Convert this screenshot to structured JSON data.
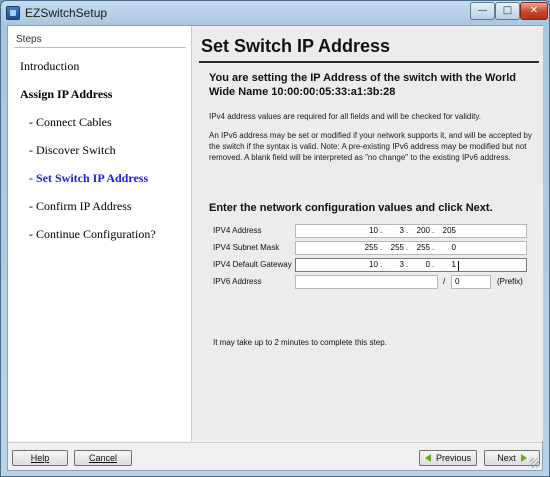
{
  "window": {
    "title": "EZSwitchSetup",
    "minimize_glyph": "—",
    "maximize_glyph": "□",
    "close_glyph": "✕",
    "icon": "app-icon"
  },
  "sidebar": {
    "heading": "Steps",
    "steps": [
      {
        "label": "Introduction",
        "state": "normal"
      },
      {
        "label": "Assign IP Address",
        "state": "bold"
      },
      {
        "label": "- Connect Cables",
        "state": "normal"
      },
      {
        "label": "- Discover Switch",
        "state": "normal"
      },
      {
        "label": "- Set Switch IP Address",
        "state": "active"
      },
      {
        "label": "- Confirm IP Address",
        "state": "normal"
      },
      {
        "label": "- Continue Configuration?",
        "state": "normal"
      }
    ]
  },
  "main": {
    "title": "Set Switch IP Address",
    "lead": "You are setting the IP Address of the switch with the World Wide Name 10:00:00:05:33:a1:3b:28",
    "para1": "IPv4 address values are required for all fields and will be checked for validity.",
    "para2": "An IPv6 address may be set or modified if your network supports it, and will be accepted by the switch if the syntax is valid. Note: A pre-existing IPv6 address may be modified but not removed. A blank field will be interpreted as \"no change\" to the existing IPv6 address.",
    "section_heading": "Enter the network configuration values and click Next.",
    "fields": {
      "ipv4_address": {
        "label": "IPV4 Address",
        "octets": [
          "10",
          "3",
          "200",
          "205"
        ]
      },
      "ipv4_subnet": {
        "label": "IPV4 Subnet Mask",
        "octets": [
          "255",
          "255",
          "255",
          "0"
        ]
      },
      "ipv4_gateway": {
        "label": "IPV4 Default Gateway",
        "octets": [
          "10",
          "3",
          "0",
          "1"
        ]
      },
      "ipv6_address": {
        "label": "IPV6 Address",
        "value": "",
        "slash": "/",
        "prefix": "0",
        "prefix_label": "(Prefix)"
      }
    },
    "note": "It may take up to 2 minutes to complete this step."
  },
  "buttons": {
    "help": "Help",
    "cancel": "Cancel",
    "previous": "Previous",
    "next": "Next"
  },
  "colors": {
    "active_step": "#1a22e0",
    "arrow": "#6aa82b"
  }
}
